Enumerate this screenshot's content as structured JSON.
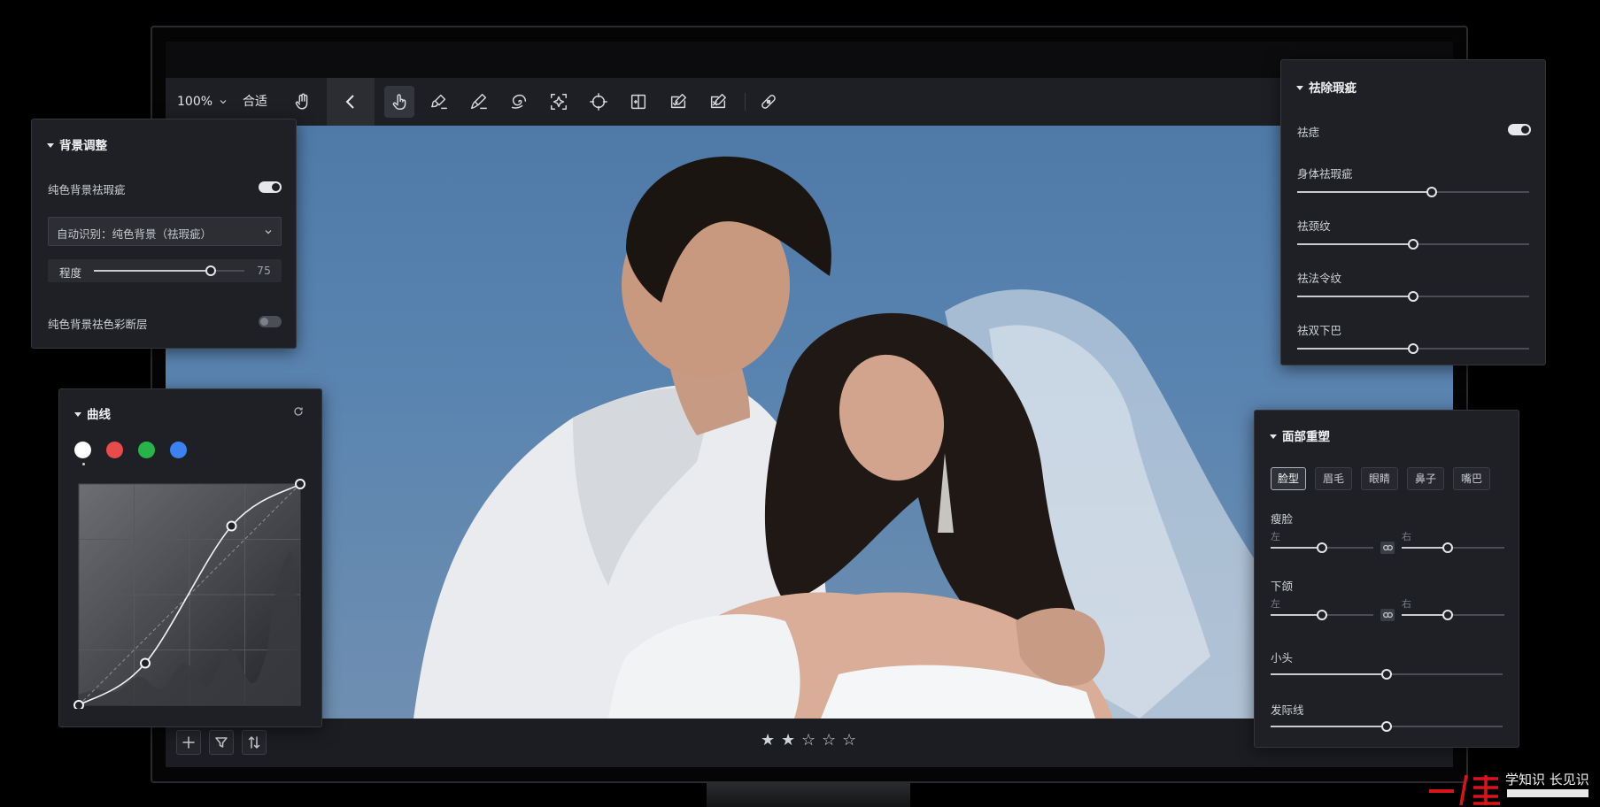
{
  "toolbar": {
    "zoom_value": "100%",
    "fit_label": "合适",
    "icons": [
      "hand-icon",
      "back-icon",
      "touch-icon",
      "brush-icon",
      "brush-pen-icon",
      "swirl-icon",
      "sparkle-icon",
      "crosshair-icon",
      "split-icon",
      "edit-check-icon",
      "edit-x-icon",
      "bandage-icon"
    ]
  },
  "background_panel": {
    "title": "背景调整",
    "toggle1_label": "纯色背景祛瑕疵",
    "toggle1_on": true,
    "dropdown_value": "自动识别：纯色背景（祛瑕疵）",
    "slider_label": "程度",
    "slider_value": "75",
    "toggle2_label": "纯色背景祛色彩断层",
    "toggle2_on": false
  },
  "curves_panel": {
    "title": "曲线",
    "channels": [
      "#ffffff",
      "#e84b4b",
      "#27b54b",
      "#3b82f0"
    ],
    "selected_channel": 0,
    "points": [
      [
        0,
        0
      ],
      [
        0.3,
        0.19
      ],
      [
        0.69,
        0.81
      ],
      [
        1,
        1
      ]
    ]
  },
  "blemish_panel": {
    "title": "祛除瑕疵",
    "toggle_label": "祛痣",
    "toggle_on": true,
    "sliders": [
      {
        "label": "身体祛瑕疵",
        "value": 0.58
      },
      {
        "label": "祛颈纹",
        "value": 0.5
      },
      {
        "label": "祛法令纹",
        "value": 0.5
      },
      {
        "label": "祛双下巴",
        "value": 0.5
      }
    ]
  },
  "face_panel": {
    "title": "面部重塑",
    "tabs": [
      "脸型",
      "眉毛",
      "眼睛",
      "鼻子",
      "嘴巴"
    ],
    "selected_tab": 0,
    "paired": [
      {
        "label": "瘦脸",
        "left_label": "左",
        "right_label": "右",
        "left_value": 0.5,
        "right_value": 0.45
      },
      {
        "label": "下颌",
        "left_label": "左",
        "right_label": "右",
        "left_value": 0.5,
        "right_value": 0.45
      }
    ],
    "single": [
      {
        "label": "小头",
        "value": 0.5
      },
      {
        "label": "发际线",
        "value": 0.5
      }
    ]
  },
  "bottom_bar": {
    "rating": 2,
    "max_rating": 5,
    "star_filled": "★",
    "star_empty": "☆",
    "icons": [
      "plus-icon",
      "filter-icon",
      "sort-icon"
    ]
  },
  "watermark": {
    "text": "学知识 长见识"
  }
}
